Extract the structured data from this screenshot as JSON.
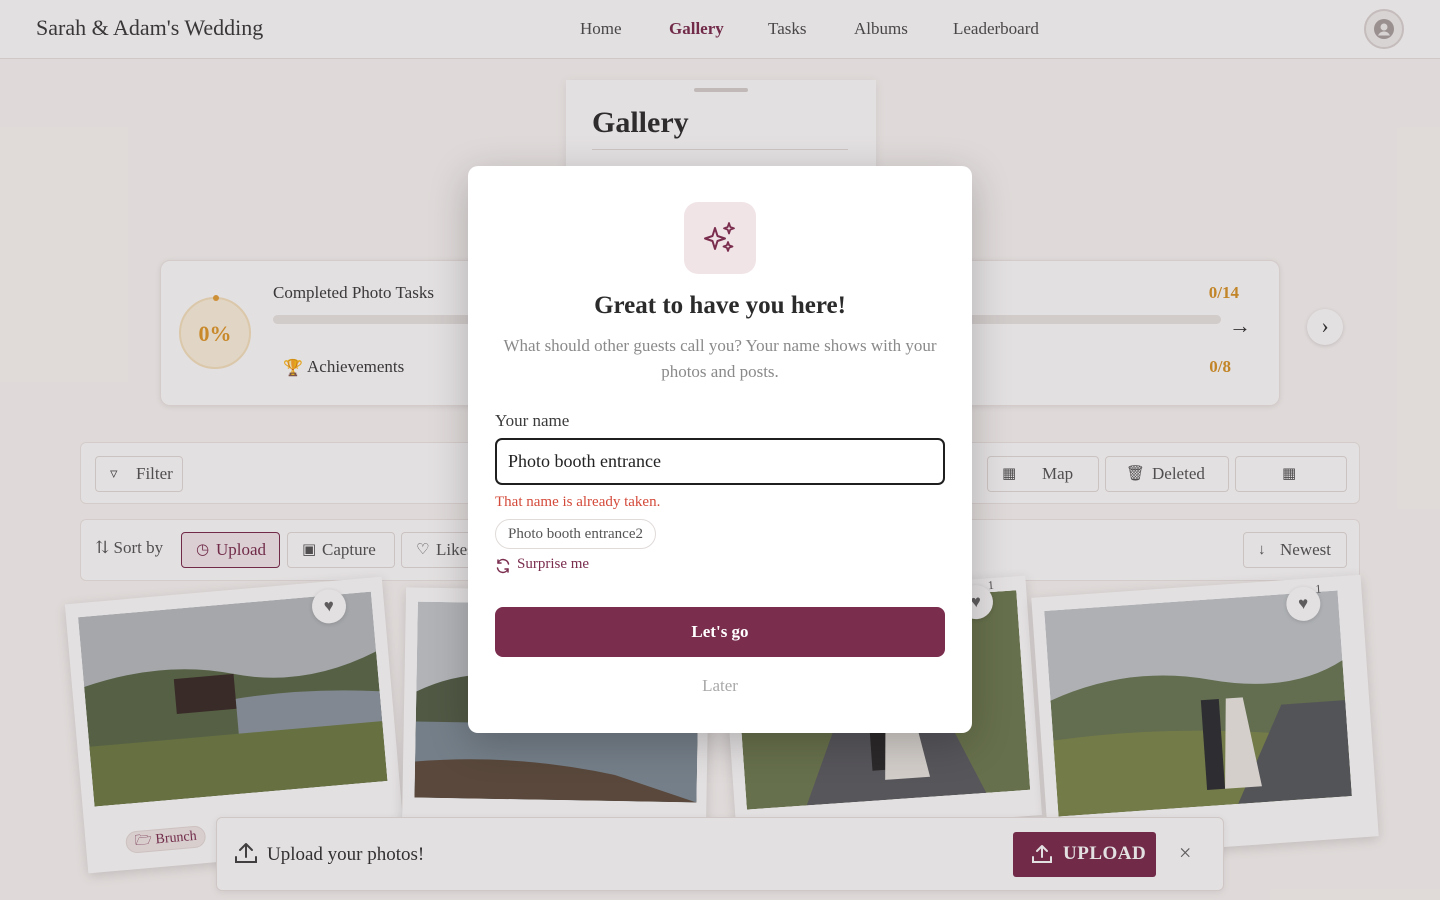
{
  "header": {
    "brand": "Sarah & Adam's Wedding",
    "nav": [
      {
        "label": "Home",
        "active": false
      },
      {
        "label": "Gallery",
        "active": true
      },
      {
        "label": "Tasks",
        "active": false
      },
      {
        "label": "Albums",
        "active": false
      },
      {
        "label": "Leaderboard",
        "active": false
      }
    ],
    "avatar_icon": "user-avatar-icon"
  },
  "page": {
    "title": "Gallery"
  },
  "progress": {
    "percent_label": "0%",
    "tasks_label": "Completed Photo Tasks",
    "tasks_count": "0/14",
    "tasks_fraction": 0,
    "achievements_label": "Achievements",
    "achievements_count": "0/8"
  },
  "toolbar": {
    "filter_label": "Filter",
    "map_label": "Map",
    "deleted_label": "Deleted"
  },
  "sortbar": {
    "sort_label": "Sort by",
    "options": [
      "Upload",
      "Capture",
      "Likes"
    ],
    "selected": "Upload",
    "order_label": "Newest"
  },
  "photos": {
    "tag_label": "Brunch",
    "like_counts": [
      "1",
      "1"
    ]
  },
  "upload_bar": {
    "text": "Upload your photos!",
    "button_label": "UPLOAD"
  },
  "modal": {
    "title": "Great to have you here!",
    "subtitle": "What should other guests call you? Your name shows with your photos and posts.",
    "field_label": "Your name",
    "input_value": "Photo booth entrance",
    "error": "That name is already taken.",
    "suggestion": "Photo booth entrance2",
    "surprise_label": "Surprise me",
    "primary_label": "Let's go",
    "later_label": "Later"
  },
  "colors": {
    "accent": "#7b2d4e",
    "accent_light": "#f1e4e7",
    "error": "#d44a3a",
    "progress": "#d99528"
  }
}
